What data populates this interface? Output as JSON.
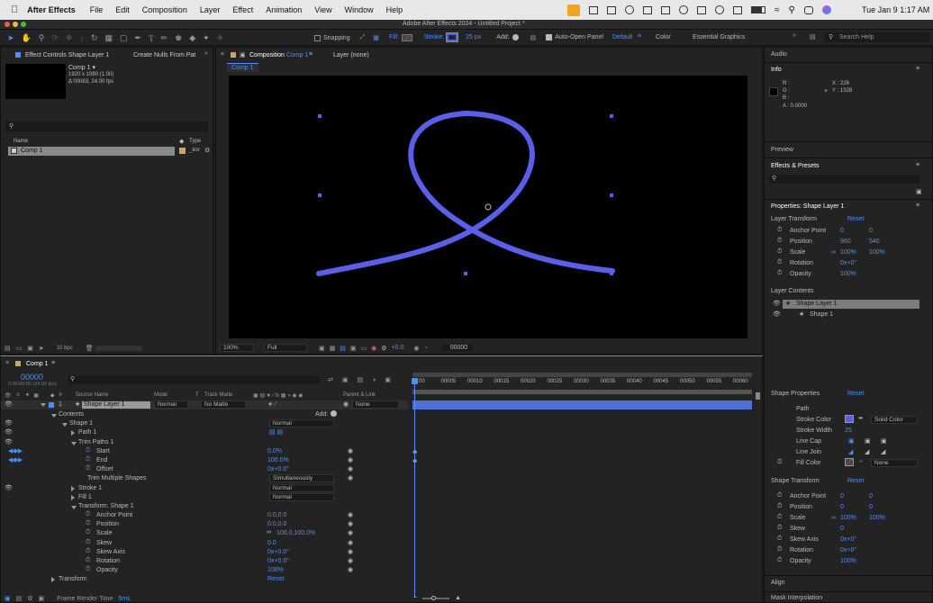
{
  "menubar": {
    "app": "After Effects",
    "items": [
      "File",
      "Edit",
      "Composition",
      "Layer",
      "Effect",
      "Animation",
      "View",
      "Window",
      "Help"
    ],
    "clock": "Tue Jan 9  1:17 AM"
  },
  "window": {
    "title": "Adobe After Effects 2024 - Untitled Project *"
  },
  "toolbar": {
    "snapping": "Snapping",
    "fill": "Fill:",
    "stroke": "Stroke:",
    "stroke_width": "25 px",
    "add": "Add:",
    "auto_open": "Auto-Open Panel",
    "workspace_default": "Default",
    "workspace_color": "Color",
    "workspace_essential": "Essential Graphics",
    "search_placeholder": "Search Help"
  },
  "project": {
    "tab_effect": "Effect Controls Shape Layer 1",
    "tab_nulls": "Create Nulls From Pat",
    "comp_name": "Comp 1 ▾",
    "comp_res": "1920 x 1080 (1.00)",
    "comp_dur": "Δ 00063, 24.00 fps",
    "col_name": "Name",
    "col_type": "Type",
    "item_name": "Comp 1",
    "item_type": "_tior",
    "bpc": "32 bpc"
  },
  "viewer": {
    "tab": "Composition",
    "tab_comp": "Comp 1",
    "layer_tab": "Layer (none)",
    "breadcrumb": "Comp 1",
    "zoom": "100%",
    "quality": "Full",
    "exposure": "+0.0",
    "timecode": "00000"
  },
  "info": {
    "title": "Info",
    "r": "R :",
    "g": "G :",
    "b": "B :",
    "a": "A :  0.0000",
    "x": "X : 226",
    "y": "Y : 1328"
  },
  "panels": {
    "audio": "Audio",
    "preview": "Preview",
    "effects": "Effects & Presets",
    "align": "Align",
    "mask": "Mask Interpolation"
  },
  "props": {
    "title": "Properties: Shape Layer 1",
    "layer_transform": "Layer Transform",
    "reset": "Reset",
    "lt": [
      {
        "label": "Anchor Point",
        "v1": "0",
        "v2": "0"
      },
      {
        "label": "Position",
        "v1": "960",
        "v2": "540"
      },
      {
        "label": "Scale",
        "v1": "100%",
        "v2": "100%"
      },
      {
        "label": "Rotation",
        "v1": "0x+0°",
        "v2": ""
      },
      {
        "label": "Opacity",
        "v1": "100%",
        "v2": ""
      }
    ],
    "layer_contents": "Layer Contents",
    "lc1": "Shape Layer 1",
    "lc2": "Shape 1",
    "shape_props": "Shape Properties",
    "path": "Path",
    "stroke_color": "Stroke Color",
    "stroke_color_val": "Solid Color",
    "stroke_width": "Stroke Width",
    "stroke_width_val": "25",
    "line_cap": "Line Cap",
    "line_join": "Line Join",
    "fill_color": "Fill Color",
    "fill_color_val": "None",
    "shape_transform": "Shape Transform",
    "st": [
      {
        "label": "Anchor Point",
        "v1": "0",
        "v2": "0"
      },
      {
        "label": "Position",
        "v1": "0",
        "v2": "0"
      },
      {
        "label": "Scale",
        "v1": "100%",
        "v2": "100%"
      },
      {
        "label": "Skew",
        "v1": "0",
        "v2": ""
      },
      {
        "label": "Skew Axis",
        "v1": "0x+0°",
        "v2": ""
      },
      {
        "label": "Rotation",
        "v1": "0x+0°",
        "v2": ""
      },
      {
        "label": "Opacity",
        "v1": "100%",
        "v2": ""
      }
    ]
  },
  "timeline": {
    "tab": "Comp 1",
    "timecode": "00000",
    "sub": "0:00:00:00 (24.00 fps)",
    "col_source": "Source Name",
    "col_mode": "Mode",
    "col_t": "T",
    "col_track": "Track Matte",
    "col_parent": "Parent & Link",
    "layer_num": "1",
    "layer_name": "Shape Layer 1",
    "layer_mode": "Normal",
    "track_matte": "No Matte",
    "parent": "None",
    "add": "Add:",
    "ruler": [
      "0:00",
      "00005",
      "00010",
      "00015",
      "00020",
      "00025",
      "00030",
      "00035",
      "00040",
      "00045",
      "00050",
      "00055",
      "00060"
    ],
    "rows": [
      {
        "label": "Contents",
        "indent": 56,
        "tri": "down",
        "value": "",
        "eye": false,
        "sw": false
      },
      {
        "label": "Shape 1",
        "indent": 68,
        "tri": "down",
        "value": "Normal",
        "dd": true,
        "eye": true,
        "sw": false
      },
      {
        "label": "Path 1",
        "indent": 78,
        "tri": "right",
        "value": "",
        "eye": true,
        "sw": false
      },
      {
        "label": "Trim Paths 1",
        "indent": 78,
        "tri": "down",
        "value": "",
        "eye": true,
        "sw": false
      },
      {
        "label": "Start",
        "indent": 96,
        "tri": "",
        "value": "0.0%",
        "eye": false,
        "sw": true
      },
      {
        "label": "End",
        "indent": 96,
        "tri": "",
        "value": "100.0%",
        "eye": false,
        "sw": true
      },
      {
        "label": "Offset",
        "indent": 96,
        "tri": "",
        "value": "0x+0.0°",
        "eye": false,
        "sw": true
      },
      {
        "label": "Trim Multiple Shapes",
        "indent": 96,
        "tri": "",
        "value": "Simultaneously",
        "dd": true,
        "eye": false,
        "sw": false
      },
      {
        "label": "Stroke 1",
        "indent": 78,
        "tri": "right",
        "value": "Normal",
        "dd": true,
        "eye": true,
        "sw": false
      },
      {
        "label": "Fill 1",
        "indent": 78,
        "tri": "right",
        "value": "Normal",
        "dd": true,
        "eye": false,
        "sw": false
      },
      {
        "label": "Transform: Shape 1",
        "indent": 78,
        "tri": "down",
        "value": "",
        "eye": false,
        "sw": false
      },
      {
        "label": "Anchor Point",
        "indent": 96,
        "tri": "",
        "value": "0.0,0.0",
        "eye": false,
        "sw": true
      },
      {
        "label": "Position",
        "indent": 96,
        "tri": "",
        "value": "0.0,0.0",
        "eye": false,
        "sw": true
      },
      {
        "label": "Scale",
        "indent": 96,
        "tri": "",
        "value": "100.0,100.0%",
        "eye": false,
        "sw": true
      },
      {
        "label": "Skew",
        "indent": 96,
        "tri": "",
        "value": "0.0",
        "eye": false,
        "sw": true
      },
      {
        "label": "Skew Axis",
        "indent": 96,
        "tri": "",
        "value": "0x+0.0°",
        "eye": false,
        "sw": true
      },
      {
        "label": "Rotation",
        "indent": 96,
        "tri": "",
        "value": "0x+0.0°",
        "eye": false,
        "sw": true
      },
      {
        "label": "Opacity",
        "indent": 96,
        "tri": "",
        "value": "100%",
        "eye": false,
        "sw": true
      },
      {
        "label": "Transform",
        "indent": 56,
        "tri": "right",
        "value": "Reset",
        "eye": false,
        "sw": false
      }
    ],
    "frame_render": "Frame Render Time",
    "frame_render_val": "5ms"
  },
  "colors": {
    "stroke": "#5a5ee8",
    "accent": "#4f8ff7"
  }
}
